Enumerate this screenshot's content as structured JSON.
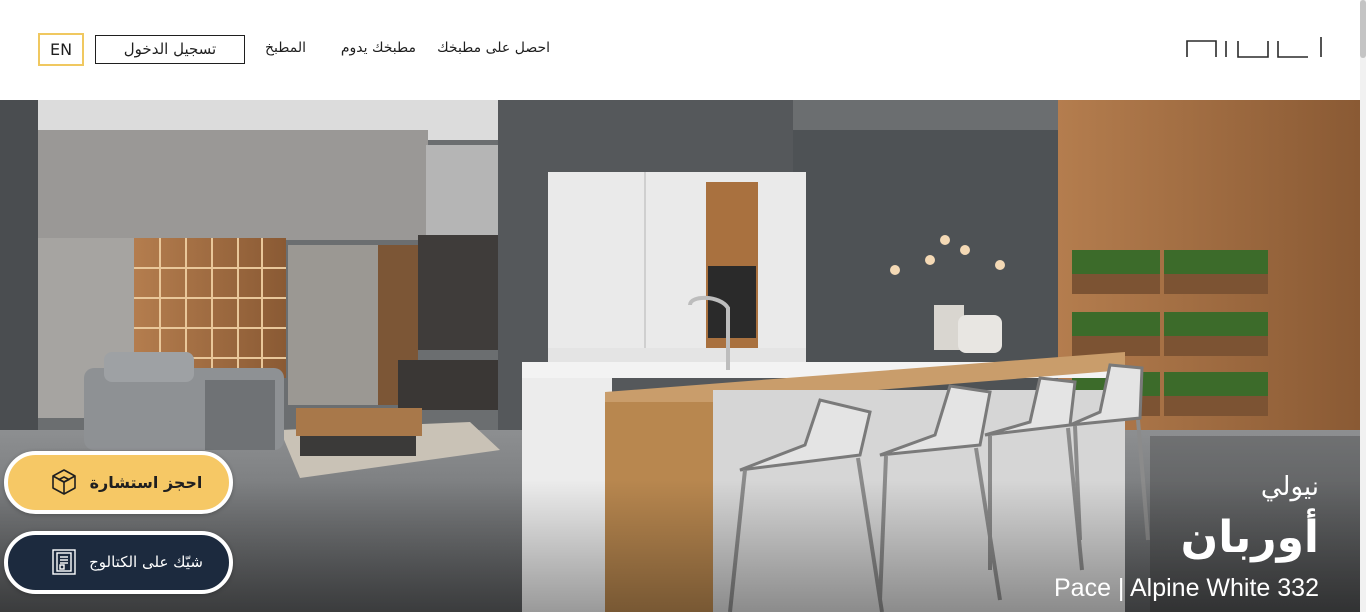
{
  "header": {
    "nav": [
      "احصل على مطبخك",
      "مطبخك يدوم",
      "المطبخ"
    ],
    "login_label": "تسجيل الدخول",
    "language_label": "EN",
    "logo_icon": "nolte-logo-icon"
  },
  "hero": {
    "brand": "نيولي",
    "model": "أوربان",
    "finish": "Pace | Alpine White 332",
    "image_description_icon": "kitchen-scene-image"
  },
  "floating_actions": {
    "consult_label": "احجز استشارة",
    "consult_icon": "cube-icon",
    "catalog_label": "شيّك على الكتالوج",
    "catalog_icon": "catalog-icon"
  },
  "colors": {
    "accent": "#f6c865",
    "dark": "#1c2a3e",
    "lang_border": "#f0c860"
  }
}
